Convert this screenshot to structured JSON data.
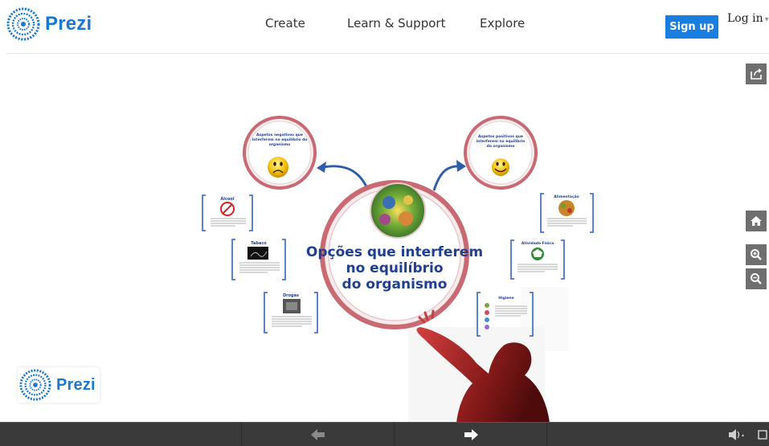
{
  "header": {
    "logo_text": "Prezi",
    "nav": [
      "Create",
      "Learn & Support",
      "Explore"
    ],
    "signup_label": "Sign up",
    "login_label": "Log in",
    "login_caret": "▾"
  },
  "viewer": {
    "center_title": [
      "Opções que interferem",
      "no equilíbrio",
      "do organismo"
    ],
    "negative_title": [
      "Aspetos negativos que",
      "interferem no equilíbrio do",
      "organismo"
    ],
    "positive_title": [
      "Aspetos positivos que",
      "interferem no equilíbrio",
      "do organismo"
    ],
    "negative_items": [
      "Álcool",
      "Tabaco",
      "Drogas"
    ],
    "positive_items": [
      "Alimentação",
      "Atividade Física",
      "Higiene"
    ],
    "corner_logo_text": "Prezi"
  },
  "colors": {
    "brand_blue": "#1a7de0",
    "ring_red": "#c96a73",
    "bracket_blue": "#4a74c9",
    "title_navy": "#1f3f8f",
    "toolbar_gray": "#3a3a3a"
  },
  "icons": {
    "share": "share-icon",
    "home": "home-icon",
    "zoom_in": "zoom-in-icon",
    "zoom_out": "zoom-out-icon",
    "prev": "arrow-left-icon",
    "next": "arrow-right-icon",
    "volume": "volume-icon",
    "fullscreen": "fullscreen-icon"
  }
}
